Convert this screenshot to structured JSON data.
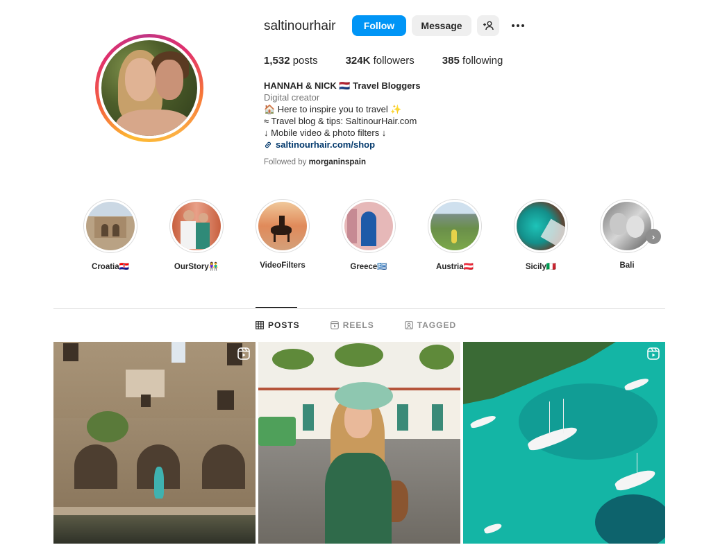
{
  "profile": {
    "username": "saltinourhair",
    "follow_label": "Follow",
    "message_label": "Message",
    "posts_count": "1,532",
    "posts_label": "posts",
    "followers_count": "324K",
    "followers_label": "followers",
    "following_count": "385",
    "following_label": "following"
  },
  "bio": {
    "name": "HANNAH & NICK 🇳🇱 Travel Bloggers",
    "category": "Digital creator",
    "line1": "🏠 Here to inspire you to travel ✨",
    "line2": "≈ Travel blog & tips: SaltinourHair.com",
    "line3": "↓ Mobile video & photo filters ↓",
    "link": "saltinourhair.com/shop",
    "followed_by_prefix": "Followed by",
    "followed_by_user": "morganinspain"
  },
  "highlights": [
    {
      "label": "Croatia🇭🇷"
    },
    {
      "label": "OurStory👫"
    },
    {
      "label": "VideoFilters"
    },
    {
      "label": "Greece🇬🇷"
    },
    {
      "label": "Austria🇦🇹"
    },
    {
      "label": "Sicily🇮🇹"
    },
    {
      "label": "Bali"
    }
  ],
  "tabs": [
    {
      "label": "POSTS",
      "icon": "grid-icon",
      "active": true
    },
    {
      "label": "REELS",
      "icon": "reels-icon",
      "active": false
    },
    {
      "label": "TAGGED",
      "icon": "tagged-icon",
      "active": false
    }
  ],
  "colors": {
    "accent": "#0095f6",
    "link": "#00376b",
    "secondary_text": "#737373"
  }
}
